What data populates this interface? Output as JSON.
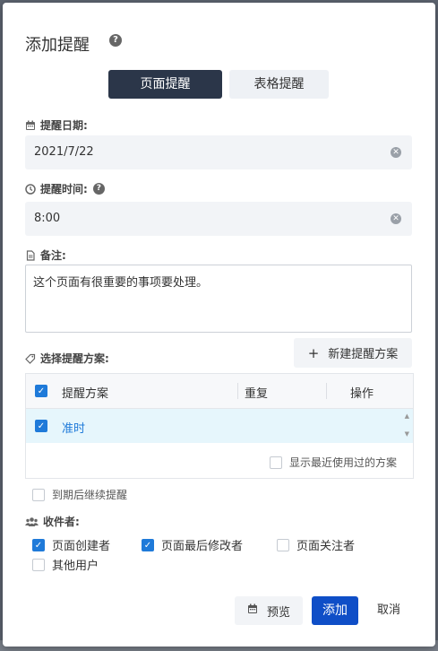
{
  "dialog": {
    "title": "添加提醒"
  },
  "tabs": [
    {
      "label": "页面提醒",
      "active": true
    },
    {
      "label": "表格提醒",
      "active": false
    }
  ],
  "date": {
    "label": "提醒日期:",
    "value": "2021/7/22"
  },
  "time": {
    "label": "提醒时间:",
    "value": "8:00"
  },
  "note": {
    "label": "备注:",
    "value": "这个页面有很重要的事项要处理。"
  },
  "plans": {
    "label": "选择提醒方案:",
    "new_button": "新建提醒方案",
    "columns": [
      "提醒方案",
      "重复",
      "操作"
    ],
    "rows": [
      {
        "name": "准时",
        "checked": true
      }
    ],
    "show_recent_label": "显示最近使用过的方案"
  },
  "continue_after_due": {
    "label": "到期后继续提醒",
    "checked": false
  },
  "recipients": {
    "label": "收件者:",
    "options": [
      {
        "label": "页面创建者",
        "checked": true
      },
      {
        "label": "页面最后修改者",
        "checked": true
      },
      {
        "label": "页面关注者",
        "checked": false
      },
      {
        "label": "其他用户",
        "checked": false
      }
    ]
  },
  "buttons": {
    "preview": "预览",
    "add": "添加",
    "cancel": "取消"
  },
  "colors": {
    "primary": "#0f4ec7",
    "tab_active": "#2b3649",
    "checkbox": "#1f7ad9",
    "link": "#1f7ad9",
    "selected_row": "#e6f6fc"
  }
}
